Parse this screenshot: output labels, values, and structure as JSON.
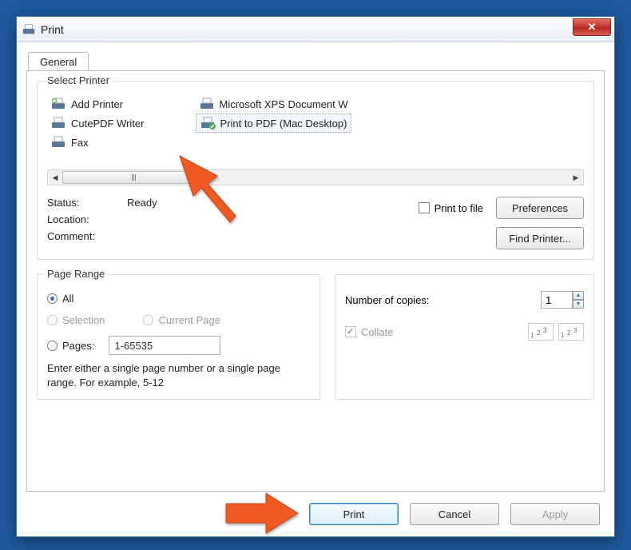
{
  "window": {
    "title": "Print"
  },
  "tabs": {
    "general": "General"
  },
  "printerGroup": {
    "title": "Select Printer",
    "items": [
      {
        "label": "Add Printer"
      },
      {
        "label": "CutePDF Writer"
      },
      {
        "label": "Fax"
      },
      {
        "label": "Microsoft XPS Document W"
      },
      {
        "label": "Print to PDF (Mac Desktop)"
      }
    ],
    "status": {
      "statusLabel": "Status:",
      "statusValue": "Ready",
      "locationLabel": "Location:",
      "commentLabel": "Comment:"
    },
    "printToFile": "Print to file",
    "preferences": "Preferences",
    "findPrinter": "Find Printer..."
  },
  "range": {
    "title": "Page Range",
    "all": "All",
    "selection": "Selection",
    "currentPage": "Current Page",
    "pages": "Pages:",
    "pagesValue": "1-65535",
    "help": "Enter either a single page number or a single page range.  For example, 5-12"
  },
  "copies": {
    "label": "Number of copies:",
    "value": "1",
    "collate": "Collate",
    "collatePreview": "1 2 3"
  },
  "buttons": {
    "print": "Print",
    "cancel": "Cancel",
    "apply": "Apply"
  }
}
